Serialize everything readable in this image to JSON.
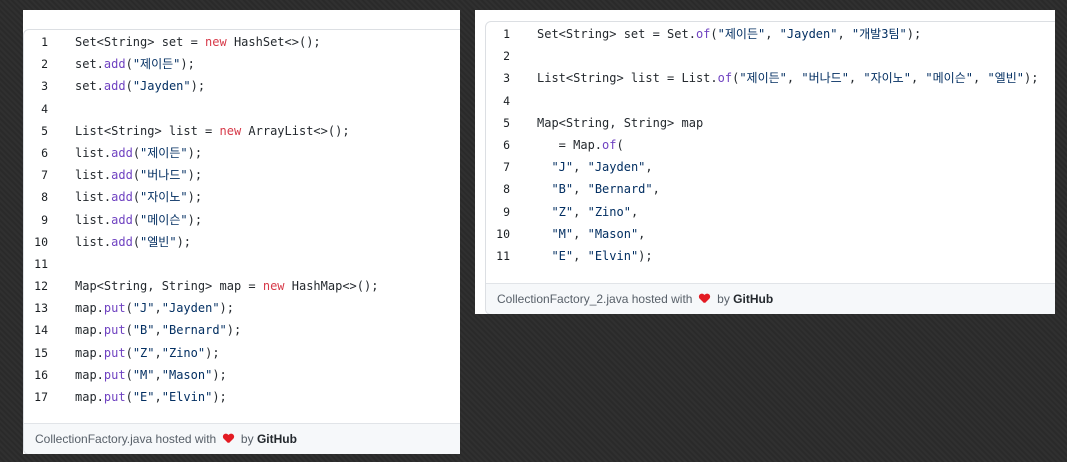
{
  "left_gist": {
    "filename": "CollectionFactory.java",
    "hosted_with": "hosted with",
    "by_text": "by",
    "github": "GitHub",
    "lines": [
      {
        "n": "1",
        "tokens": [
          {
            "t": "Set<String> set = ",
            "c": ""
          },
          {
            "t": "new",
            "c": "kw"
          },
          {
            "t": " HashSet<>();",
            "c": ""
          }
        ]
      },
      {
        "n": "2",
        "tokens": [
          {
            "t": "set.",
            "c": ""
          },
          {
            "t": "add",
            "c": "fn"
          },
          {
            "t": "(",
            "c": ""
          },
          {
            "t": "\"제이든\"",
            "c": "str"
          },
          {
            "t": ");",
            "c": ""
          }
        ]
      },
      {
        "n": "3",
        "tokens": [
          {
            "t": "set.",
            "c": ""
          },
          {
            "t": "add",
            "c": "fn"
          },
          {
            "t": "(",
            "c": ""
          },
          {
            "t": "\"Jayden\"",
            "c": "str"
          },
          {
            "t": ");",
            "c": ""
          }
        ]
      },
      {
        "n": "4",
        "tokens": []
      },
      {
        "n": "5",
        "tokens": [
          {
            "t": "List<String> list = ",
            "c": ""
          },
          {
            "t": "new",
            "c": "kw"
          },
          {
            "t": " ArrayList<>();",
            "c": ""
          }
        ]
      },
      {
        "n": "6",
        "tokens": [
          {
            "t": "list.",
            "c": ""
          },
          {
            "t": "add",
            "c": "fn"
          },
          {
            "t": "(",
            "c": ""
          },
          {
            "t": "\"제이든\"",
            "c": "str"
          },
          {
            "t": ");",
            "c": ""
          }
        ]
      },
      {
        "n": "7",
        "tokens": [
          {
            "t": "list.",
            "c": ""
          },
          {
            "t": "add",
            "c": "fn"
          },
          {
            "t": "(",
            "c": ""
          },
          {
            "t": "\"버나드\"",
            "c": "str"
          },
          {
            "t": ");",
            "c": ""
          }
        ]
      },
      {
        "n": "8",
        "tokens": [
          {
            "t": "list.",
            "c": ""
          },
          {
            "t": "add",
            "c": "fn"
          },
          {
            "t": "(",
            "c": ""
          },
          {
            "t": "\"자이노\"",
            "c": "str"
          },
          {
            "t": ");",
            "c": ""
          }
        ]
      },
      {
        "n": "9",
        "tokens": [
          {
            "t": "list.",
            "c": ""
          },
          {
            "t": "add",
            "c": "fn"
          },
          {
            "t": "(",
            "c": ""
          },
          {
            "t": "\"메이슨\"",
            "c": "str"
          },
          {
            "t": ");",
            "c": ""
          }
        ]
      },
      {
        "n": "10",
        "tokens": [
          {
            "t": "list.",
            "c": ""
          },
          {
            "t": "add",
            "c": "fn"
          },
          {
            "t": "(",
            "c": ""
          },
          {
            "t": "\"엘빈\"",
            "c": "str"
          },
          {
            "t": ");",
            "c": ""
          }
        ]
      },
      {
        "n": "11",
        "tokens": []
      },
      {
        "n": "12",
        "tokens": [
          {
            "t": "Map<String, String> map = ",
            "c": ""
          },
          {
            "t": "new",
            "c": "kw"
          },
          {
            "t": " HashMap<>();",
            "c": ""
          }
        ]
      },
      {
        "n": "13",
        "tokens": [
          {
            "t": "map.",
            "c": ""
          },
          {
            "t": "put",
            "c": "fn"
          },
          {
            "t": "(",
            "c": ""
          },
          {
            "t": "\"J\"",
            "c": "str"
          },
          {
            "t": ",",
            "c": ""
          },
          {
            "t": "\"Jayden\"",
            "c": "str"
          },
          {
            "t": ");",
            "c": ""
          }
        ]
      },
      {
        "n": "14",
        "tokens": [
          {
            "t": "map.",
            "c": ""
          },
          {
            "t": "put",
            "c": "fn"
          },
          {
            "t": "(",
            "c": ""
          },
          {
            "t": "\"B\"",
            "c": "str"
          },
          {
            "t": ",",
            "c": ""
          },
          {
            "t": "\"Bernard\"",
            "c": "str"
          },
          {
            "t": ");",
            "c": ""
          }
        ]
      },
      {
        "n": "15",
        "tokens": [
          {
            "t": "map.",
            "c": ""
          },
          {
            "t": "put",
            "c": "fn"
          },
          {
            "t": "(",
            "c": ""
          },
          {
            "t": "\"Z\"",
            "c": "str"
          },
          {
            "t": ",",
            "c": ""
          },
          {
            "t": "\"Zino\"",
            "c": "str"
          },
          {
            "t": ");",
            "c": ""
          }
        ]
      },
      {
        "n": "16",
        "tokens": [
          {
            "t": "map.",
            "c": ""
          },
          {
            "t": "put",
            "c": "fn"
          },
          {
            "t": "(",
            "c": ""
          },
          {
            "t": "\"M\"",
            "c": "str"
          },
          {
            "t": ",",
            "c": ""
          },
          {
            "t": "\"Mason\"",
            "c": "str"
          },
          {
            "t": ");",
            "c": ""
          }
        ]
      },
      {
        "n": "17",
        "tokens": [
          {
            "t": "map.",
            "c": ""
          },
          {
            "t": "put",
            "c": "fn"
          },
          {
            "t": "(",
            "c": ""
          },
          {
            "t": "\"E\"",
            "c": "str"
          },
          {
            "t": ",",
            "c": ""
          },
          {
            "t": "\"Elvin\"",
            "c": "str"
          },
          {
            "t": ");",
            "c": ""
          }
        ]
      }
    ]
  },
  "right_gist": {
    "filename": "CollectionFactory_2.java",
    "hosted_with": "hosted with",
    "by_text": "by",
    "github": "GitHub",
    "lines": [
      {
        "n": "1",
        "tokens": [
          {
            "t": "Set<String> set = Set.",
            "c": ""
          },
          {
            "t": "of",
            "c": "fn"
          },
          {
            "t": "(",
            "c": ""
          },
          {
            "t": "\"제이든\"",
            "c": "str"
          },
          {
            "t": ", ",
            "c": ""
          },
          {
            "t": "\"Jayden\"",
            "c": "str"
          },
          {
            "t": ", ",
            "c": ""
          },
          {
            "t": "\"개발3팀\"",
            "c": "str"
          },
          {
            "t": ");",
            "c": ""
          }
        ]
      },
      {
        "n": "2",
        "tokens": []
      },
      {
        "n": "3",
        "tokens": [
          {
            "t": "List<String> list = List.",
            "c": ""
          },
          {
            "t": "of",
            "c": "fn"
          },
          {
            "t": "(",
            "c": ""
          },
          {
            "t": "\"제이든\"",
            "c": "str"
          },
          {
            "t": ", ",
            "c": ""
          },
          {
            "t": "\"버나드\"",
            "c": "str"
          },
          {
            "t": ", ",
            "c": ""
          },
          {
            "t": "\"자이노\"",
            "c": "str"
          },
          {
            "t": ", ",
            "c": ""
          },
          {
            "t": "\"메이슨\"",
            "c": "str"
          },
          {
            "t": ", ",
            "c": ""
          },
          {
            "t": "\"엘빈\"",
            "c": "str"
          },
          {
            "t": ");",
            "c": ""
          }
        ]
      },
      {
        "n": "4",
        "tokens": []
      },
      {
        "n": "5",
        "tokens": [
          {
            "t": "Map<String, String> map",
            "c": ""
          }
        ]
      },
      {
        "n": "6",
        "tokens": [
          {
            "t": "   = Map.",
            "c": ""
          },
          {
            "t": "of",
            "c": "fn"
          },
          {
            "t": "(",
            "c": ""
          }
        ]
      },
      {
        "n": "7",
        "tokens": [
          {
            "t": "  ",
            "c": ""
          },
          {
            "t": "\"J\"",
            "c": "str"
          },
          {
            "t": ", ",
            "c": ""
          },
          {
            "t": "\"Jayden\"",
            "c": "str"
          },
          {
            "t": ",",
            "c": ""
          }
        ]
      },
      {
        "n": "8",
        "tokens": [
          {
            "t": "  ",
            "c": ""
          },
          {
            "t": "\"B\"",
            "c": "str"
          },
          {
            "t": ", ",
            "c": ""
          },
          {
            "t": "\"Bernard\"",
            "c": "str"
          },
          {
            "t": ",",
            "c": ""
          }
        ]
      },
      {
        "n": "9",
        "tokens": [
          {
            "t": "  ",
            "c": ""
          },
          {
            "t": "\"Z\"",
            "c": "str"
          },
          {
            "t": ", ",
            "c": ""
          },
          {
            "t": "\"Zino\"",
            "c": "str"
          },
          {
            "t": ",",
            "c": ""
          }
        ]
      },
      {
        "n": "10",
        "tokens": [
          {
            "t": "  ",
            "c": ""
          },
          {
            "t": "\"M\"",
            "c": "str"
          },
          {
            "t": ", ",
            "c": ""
          },
          {
            "t": "\"Mason\"",
            "c": "str"
          },
          {
            "t": ",",
            "c": ""
          }
        ]
      },
      {
        "n": "11",
        "tokens": [
          {
            "t": "  ",
            "c": ""
          },
          {
            "t": "\"E\"",
            "c": "str"
          },
          {
            "t": ", ",
            "c": ""
          },
          {
            "t": "\"Elvin\"",
            "c": "str"
          },
          {
            "t": ");",
            "c": ""
          }
        ]
      }
    ]
  }
}
